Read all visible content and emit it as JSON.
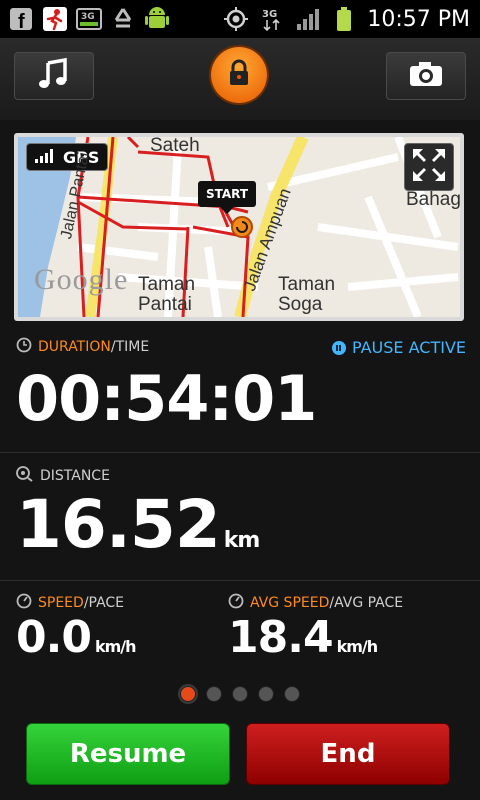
{
  "status_bar": {
    "time": "10:57 PM",
    "network": "3G",
    "icons": [
      "facebook-icon",
      "runner-app-icon",
      "3g-data-icon",
      "recycle-icon",
      "android-icon",
      "gps-target-icon",
      "signal-icon",
      "battery-icon"
    ]
  },
  "topbar": {
    "music_icon": "music-note-icon",
    "lock_icon": "lock-icon",
    "camera_icon": "camera-icon"
  },
  "map": {
    "gps_label": "GPS",
    "start_label": "START",
    "labels": {
      "sateh": "Sateh",
      "jalan_pantai": "Jalan Pantai",
      "jalan_ampuan": "Jalan Ampuan",
      "taman_pantai": "Taman\nPantai",
      "taman_soga": "Taman\nSoga",
      "kg_bahag": "Kg\nBahag",
      "google": "Google"
    },
    "colors": {
      "route": "#d81e1e",
      "road_major": "#f7e46a",
      "water": "#9ec1e6"
    }
  },
  "stats": {
    "duration": {
      "label_main": "DURATION",
      "label_sub": "/TIME",
      "value": "00:54:01"
    },
    "pause_active": "PAUSE ACTIVE",
    "distance": {
      "label": "DISTANCE",
      "value": "16.52",
      "unit": "km"
    },
    "speed": {
      "label_main": "SPEED",
      "label_sub": "/PACE",
      "value": "0.0",
      "unit": "km/h"
    },
    "avg_speed": {
      "label_main": "AVG SPEED",
      "label_sub": "/AVG PACE",
      "value": "18.4",
      "unit": "km/h"
    }
  },
  "pager": {
    "count": 5,
    "active_index": 0
  },
  "buttons": {
    "resume": "Resume",
    "end": "End"
  },
  "colors": {
    "accent_orange": "#ff8a1c",
    "accent_blue": "#42b6ff",
    "resume_green": "#1cbf22",
    "end_red": "#b30d0d"
  }
}
